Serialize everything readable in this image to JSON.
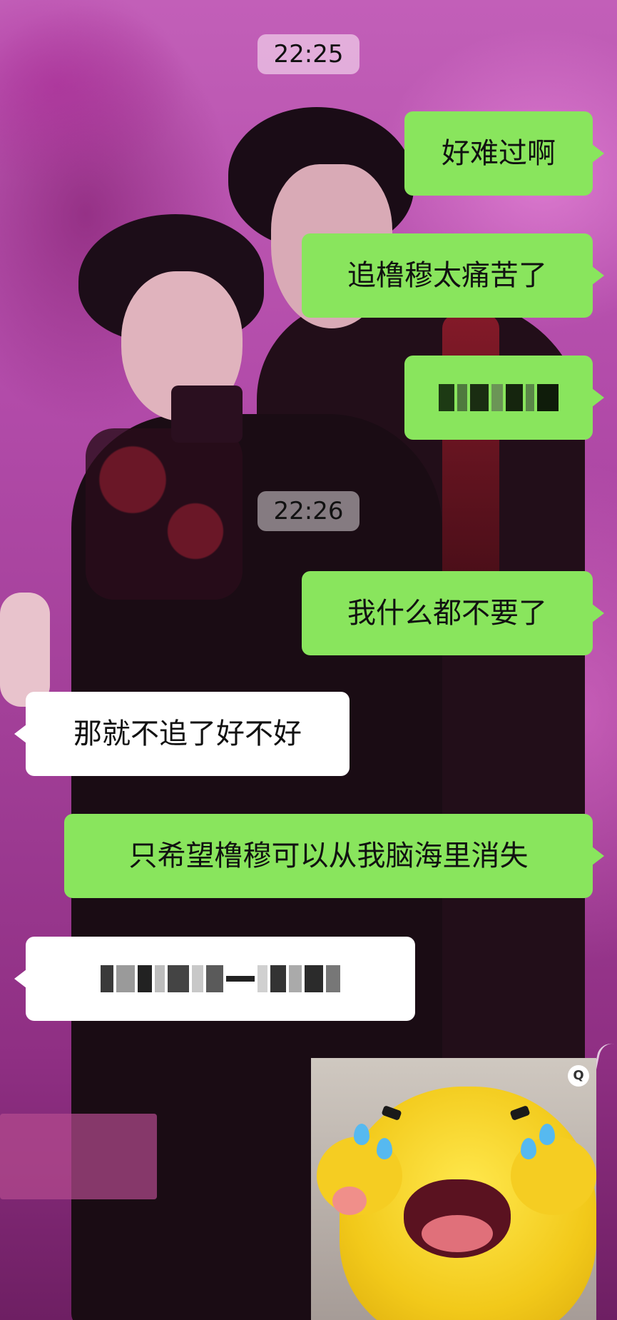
{
  "chat": {
    "timestamps": [
      "22:25",
      "22:26"
    ],
    "messages": [
      {
        "side": "right",
        "text": "好难过啊"
      },
      {
        "side": "right",
        "text": "追橹穆太痛苦了"
      },
      {
        "side": "right",
        "text": "",
        "redacted": true
      },
      {
        "side": "right",
        "text": "我什么都不要了"
      },
      {
        "side": "left",
        "text": "那就不追了好不好"
      },
      {
        "side": "right",
        "text": "只希望橹穆可以从我脑海里消失"
      },
      {
        "side": "left",
        "text": "",
        "redacted": true
      }
    ],
    "sticker": {
      "icon": "crying-yellow-character-sticker",
      "badge": "Q"
    }
  },
  "colors": {
    "outgoing_bubble": "#89e55d",
    "incoming_bubble": "#ffffff",
    "background": "#b24ba9"
  }
}
